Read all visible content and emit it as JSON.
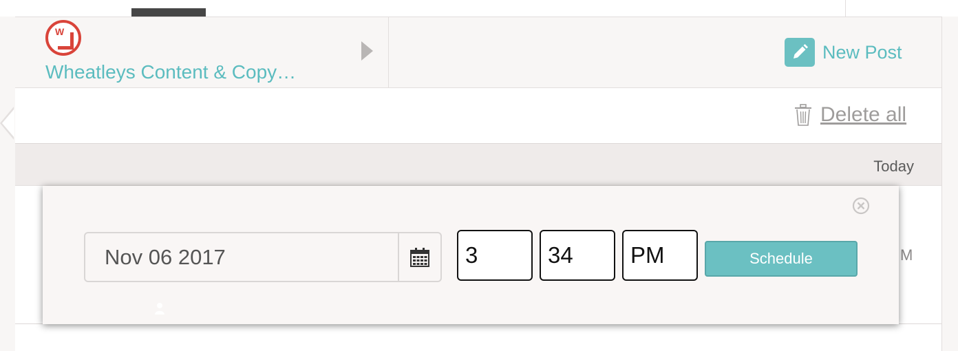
{
  "account": {
    "name": "Wheatleys Content & Copy…",
    "avatar_letter": "W",
    "avatar_color": "#d9443a"
  },
  "header": {
    "new_post_label": "New Post",
    "new_post_icon": "pencil-icon"
  },
  "toolbar": {
    "delete_all_label": "Delete all",
    "delete_icon": "trash-icon"
  },
  "day": {
    "label": "Today"
  },
  "row": {
    "peek_text": "M"
  },
  "schedule_popup": {
    "date_value": "Nov 06 2017",
    "hour": "3",
    "minute": "34",
    "ampm": "PM",
    "schedule_label": "Schedule"
  },
  "colors": {
    "accent": "#6bc0c2",
    "link": "#5bbcbf",
    "brand_red": "#d9443a",
    "background": "#f8f6f5"
  }
}
